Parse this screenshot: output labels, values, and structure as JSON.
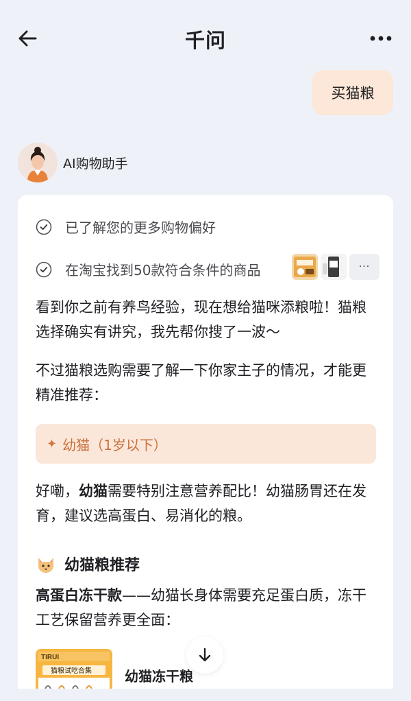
{
  "header": {
    "title": "千问",
    "back_icon": "arrow-left-icon",
    "more_icon": "more-horizontal-icon"
  },
  "user_message": "买猫粮",
  "assistant": {
    "name": "AI购物助手",
    "avatar_icon": "assistant-avatar"
  },
  "steps": [
    {
      "text": "已了解您的更多购物偏好",
      "icon": "check-circle-icon"
    },
    {
      "text": "在淘宝找到50款符合条件的商品",
      "icon": "check-circle-icon",
      "more_label": "···"
    }
  ],
  "message": {
    "para1": "看到你之前有养鸟经验，现在想给猫咪添粮啦！猫粮选择确实有讲究，我先帮你搜了一波～",
    "para2": "不过猫粮选购需要了解一下你家主子的情况，才能更精准推荐：",
    "option": "幼猫（1岁以下）",
    "para3_prefix": "好嘞，",
    "para3_bold": "幼猫",
    "para3_suffix": "需要特别注意营养配比！幼猫肠胃还在发育，建议选高蛋白、易消化的粮。",
    "section_title": "幼猫粮推荐",
    "section_icon": "cat-face-icon",
    "para4_bold": "高蛋白冻干款",
    "para4_suffix": "——幼猫长身体需要充足蛋白质，冻干工艺保留营养更全面：",
    "product_name": "幼猫冻干粮",
    "product_img_brand": "TIRUI",
    "product_img_label": "猫粮试吃合集"
  },
  "colors": {
    "background": "#eef1f8",
    "user_bubble": "#fde7d8",
    "option_bg": "#fbe7da",
    "option_text": "#c9703a"
  }
}
